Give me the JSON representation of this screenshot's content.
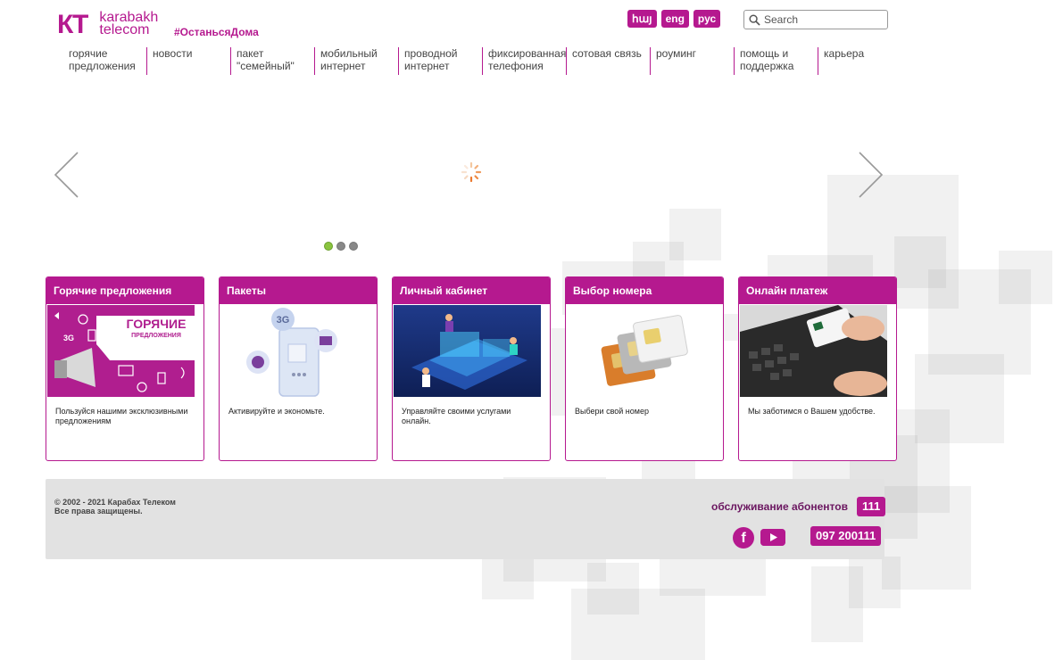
{
  "brand": {
    "logo_mark": "КТ",
    "logo_line1": "karabakh",
    "logo_line2": "telecom",
    "tagline": "#ОстаньсяДома",
    "accent": "#b5198f"
  },
  "languages": [
    "հայ",
    "eng",
    "рус"
  ],
  "search": {
    "placeholder": "Search",
    "icon": "search-icon"
  },
  "nav": [
    {
      "line1": "горячие",
      "line2": "предложения"
    },
    {
      "line1": "новости",
      "line2": ""
    },
    {
      "line1": "пакет",
      "line2": "\"семейный\""
    },
    {
      "line1": "мобильный",
      "line2": "интернет"
    },
    {
      "line1": "проводной",
      "line2": "интернет"
    },
    {
      "line1": "фиксированная",
      "line2": "телефония"
    },
    {
      "line1": "сотовая связь",
      "line2": ""
    },
    {
      "line1": "роуминг",
      "line2": ""
    },
    {
      "line1": "помощь и",
      "line2": "поддержка"
    },
    {
      "line1": "карьера",
      "line2": ""
    }
  ],
  "slider": {
    "prev_icon": "chevron-left-icon",
    "next_icon": "chevron-right-icon",
    "loading_icon": "spinner-icon",
    "dots": 3,
    "active_dot": 0,
    "active_dot_color": "#8ac43f"
  },
  "cards": [
    {
      "title": "Горячие предложения",
      "text": "Пользуйся нашими эксклюзивными предложениям",
      "banner_line1": "ГОРЯЧИЕ",
      "banner_line2": "ПРЕДЛОЖЕНИЯ",
      "badge": "3G"
    },
    {
      "title": "Пакеты",
      "text": "Активируйте и экономьте.",
      "badge": "3G"
    },
    {
      "title": "Личный кабинет",
      "text": "Управляйте своими услугами онлайн."
    },
    {
      "title": "Выбор номера",
      "text": "Выбери свой номер"
    },
    {
      "title": "Онлайн платеж",
      "text": "Мы заботимся о Вашем удобстве."
    }
  ],
  "footer": {
    "copyright_line1": "© 2002 - 2021 Карабах Телеком",
    "copyright_line2": "Все права защищены.",
    "service_label": "обслуживание абонентов",
    "service_number": "111",
    "phone": "097 200111",
    "facebook_icon": "facebook-icon",
    "youtube_icon": "youtube-icon",
    "facebook_letter": "f"
  }
}
